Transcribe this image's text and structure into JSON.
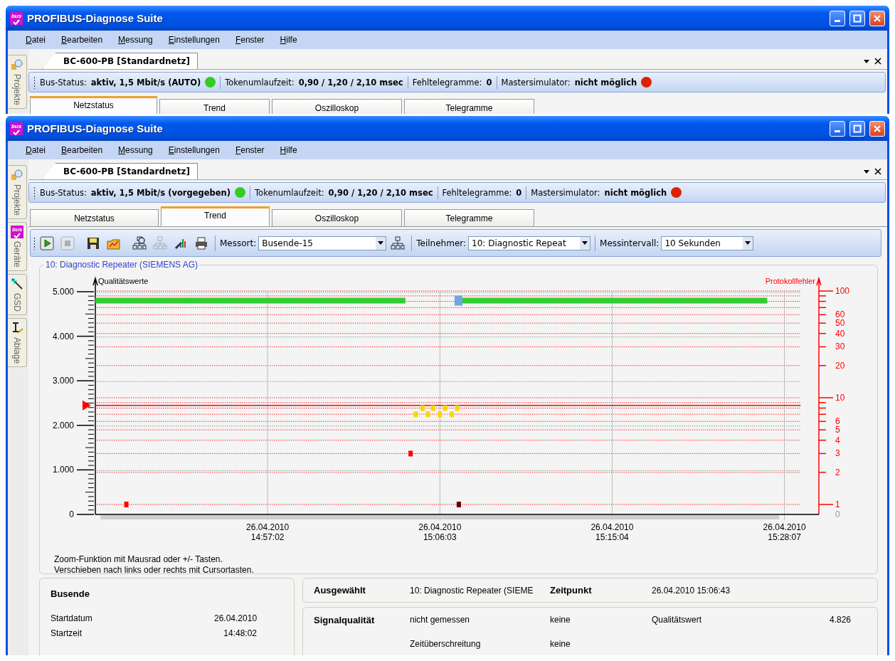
{
  "windows": [
    {
      "title": "PROFIBUS-Diagnose Suite",
      "logo_text": "bus",
      "menu": [
        "Datei",
        "Bearbeiten",
        "Messung",
        "Einstellungen",
        "Fenster",
        "Hilfe"
      ],
      "side_tabs": [
        {
          "label": "Projekte",
          "kind": "projects"
        }
      ],
      "document_tab": "BC-600-PB [Standardnetz]",
      "status": [
        {
          "label": "Bus-Status:",
          "value": "aktiv, 1,5 Mbit/s (AUTO)",
          "color": "#33cc22"
        },
        {
          "label": "Tokenumlaufzeit:",
          "value": "0,90 / 1,20 / 2,10 msec"
        },
        {
          "label": "Fehltelegramme:",
          "value": "0"
        },
        {
          "label": "Mastersimulator:",
          "value": "nicht möglich",
          "color": "#dd2200"
        }
      ],
      "tabs": [
        {
          "label": "Netzstatus",
          "selected": true
        },
        {
          "label": "Trend",
          "selected": false
        },
        {
          "label": "Oszilloskop",
          "selected": false
        },
        {
          "label": "Telegramme",
          "selected": false
        }
      ]
    },
    {
      "title": "PROFIBUS-Diagnose Suite",
      "logo_text": "bus",
      "menu": [
        "Datei",
        "Bearbeiten",
        "Messung",
        "Einstellungen",
        "Fenster",
        "Hilfe"
      ],
      "side_tabs": [
        {
          "label": "Projekte",
          "kind": "projects"
        },
        {
          "label": "Geräte",
          "kind": "devices",
          "logo_text": "bus"
        },
        {
          "label": "GSD",
          "kind": "gsd"
        },
        {
          "label": "Ablage",
          "kind": "storage"
        }
      ],
      "document_tab": "BC-600-PB [Standardnetz]",
      "status": [
        {
          "label": "Bus-Status:",
          "value": "aktiv, 1,5 Mbit/s (vorgegeben)",
          "color": "#33cc22"
        },
        {
          "label": "Tokenumlaufzeit:",
          "value": "0,90 / 1,20 / 2,10 msec"
        },
        {
          "label": "Fehltelegramme:",
          "value": "0"
        },
        {
          "label": "Mastersimulator:",
          "value": "nicht möglich",
          "color": "#dd2200"
        }
      ],
      "tabs": [
        {
          "label": "Netzstatus",
          "selected": false
        },
        {
          "label": "Trend",
          "selected": true
        },
        {
          "label": "Oszilloskop",
          "selected": false
        },
        {
          "label": "Telegramme",
          "selected": false
        }
      ],
      "toolbar": {
        "buttons": [
          {
            "kind": "play",
            "disabled": false
          },
          {
            "kind": "stop",
            "disabled": true
          },
          {
            "kind": "save",
            "disabled": false
          },
          {
            "kind": "open",
            "disabled": false
          },
          {
            "kind": "search-network",
            "disabled": false
          },
          {
            "kind": "network",
            "disabled": true
          },
          {
            "kind": "tool",
            "disabled": false
          },
          {
            "kind": "print",
            "disabled": false
          }
        ],
        "fields": [
          {
            "label": "Messort:",
            "value": "Busende-15",
            "kind": "with-button"
          },
          {
            "label": "Teilnehmer:",
            "value": "10: Diagnostic Repeat",
            "kind": "plain"
          },
          {
            "label": "Messintervall:",
            "value": "10 Sekunden",
            "kind": "plain"
          }
        ]
      },
      "chart_panel": {
        "title": "10: Diagnostic Repeater (SIEMENS AG)",
        "chart_data": {
          "type": "line",
          "grid": true,
          "ylabel": "Qualitätswerte",
          "ylim": [
            0,
            5000
          ],
          "categories": [
            null,
            null,
            null,
            null,
            null,
            null,
            null,
            null,
            null,
            null,
            "26.04.2010\n14:57:02",
            null,
            null,
            null,
            null,
            null,
            null,
            null,
            null,
            null,
            "26.04.2010\n15:06:03",
            null,
            null,
            null,
            null,
            null,
            null,
            null,
            null,
            null,
            "26.04.2010\n15:15:04",
            null,
            null,
            null,
            null,
            null,
            null,
            null,
            null,
            null,
            "26.04.2010\n15:28:07",
            null,
            null
          ],
          "yticks": [
            {
              "value": 0,
              "label": "0"
            },
            {
              "value": 1000,
              "label": "1.000"
            },
            {
              "value": 2000,
              "label": "2.000"
            },
            {
              "value": 3000,
              "label": "3.000"
            },
            {
              "value": 4000,
              "label": "4.000"
            },
            {
              "value": 5000,
              "label": "5.000"
            }
          ],
          "series": [
            {
              "color": "#33cc33",
              "values": [
                4800,
                4800,
                4800,
                4800,
                4800,
                4800,
                4800,
                4800,
                4800,
                4800,
                4800,
                4800,
                4800,
                4800,
                4800,
                4800,
                4800,
                4800,
                4800,
                null,
                null,
                4800,
                4800,
                4800,
                4800,
                4800,
                4800,
                4800,
                4800,
                4800,
                4800,
                4800,
                4800,
                4800,
                4800,
                4800,
                4800,
                4800,
                4800,
                4800,
                null,
                null,
                null
              ]
            }
          ],
          "ref_lines": [
            {
              "axis": "y",
              "value": 2450
            }
          ]
        },
        "error_axis": {
          "title": "Protokollfehler",
          "ticks": [
            "100",
            "60",
            "50",
            "40",
            "30",
            "20",
            "10",
            "6",
            "5",
            "4",
            "3",
            "2",
            "1",
            "0"
          ]
        },
        "hint": [
          "Zoom-Funktion mit Mausrad oder +/- Tasten.",
          "Verschieben nach links oder rechts mit Cursortasten."
        ]
      },
      "summary": {
        "title": "Busende",
        "rows": [
          {
            "label": "Startdatum",
            "value": "26.04.2010"
          },
          {
            "label": "Startzeit",
            "value": "14:48:02"
          }
        ]
      },
      "selection": {
        "label": "Ausgewählt",
        "value": "10: Diagnostic Repeater (SIEME",
        "time_label": "Zeitpunkt",
        "time": "26.04.2010 15:06:43"
      },
      "signal": {
        "label": "Signalqualität",
        "rows": [
          {
            "text": "nicht gemessen",
            "state": "keine",
            "extra_label": "Qualitätswert",
            "extra_value": "4.826"
          },
          {
            "text": "Zeitüberschreitung",
            "state": "keine"
          }
        ]
      }
    }
  ]
}
